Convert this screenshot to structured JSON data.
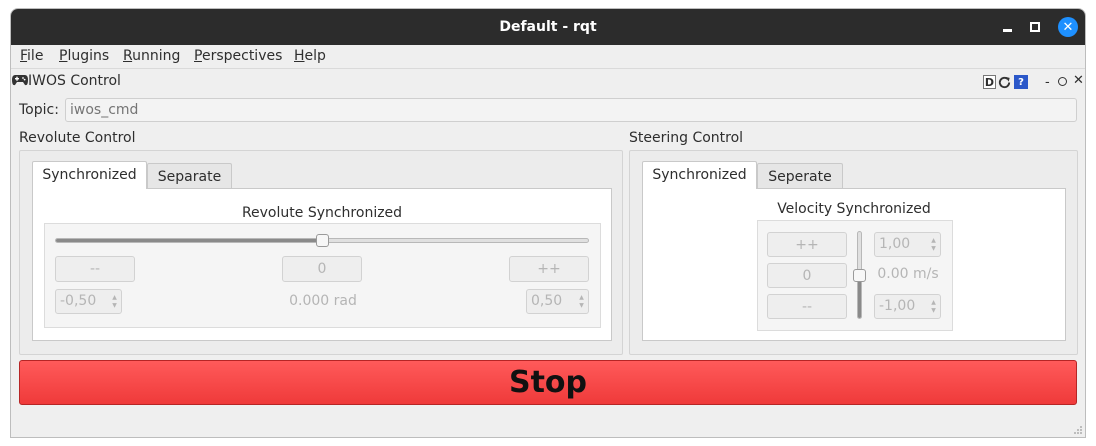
{
  "window": {
    "title": "Default - rqt",
    "min_glyph": "",
    "max_glyph": "",
    "close_glyph": "✕"
  },
  "menu": {
    "items": [
      "File",
      "Plugins",
      "Running",
      "Perspectives",
      "Help"
    ]
  },
  "plugin": {
    "title": "IWOS Control",
    "d_label": "D",
    "help_label": "?",
    "min_label": "-",
    "close_label": "✕"
  },
  "topic": {
    "label": "Topic:",
    "placeholder": "iwos_cmd",
    "value": ""
  },
  "revolute": {
    "group_title": "Revolute Control",
    "tabs": [
      "Synchronized",
      "Separate"
    ],
    "active_tab": 0,
    "subtitle": "Revolute Synchronized",
    "slider_fraction": 0.5,
    "minus_label": "--",
    "zero_label": "0",
    "plus_label": "++",
    "min_value": "-0,50",
    "readout": "0.000 rad",
    "max_value": "0,50"
  },
  "steering": {
    "group_title": "Steering Control",
    "tabs": [
      "Synchronized",
      "Seperate"
    ],
    "active_tab": 0,
    "subtitle": "Velocity Synchronized",
    "slider_fraction": 0.5,
    "plus_label": "++",
    "zero_label": "0",
    "minus_label": "--",
    "max_value": "1,00",
    "readout": "0.00 m/s",
    "min_value": "-1,00"
  },
  "stop": {
    "label": "Stop"
  },
  "colors": {
    "stop": "#f04545",
    "titlebar": "#2c2c2c",
    "close": "#1e90ff"
  }
}
